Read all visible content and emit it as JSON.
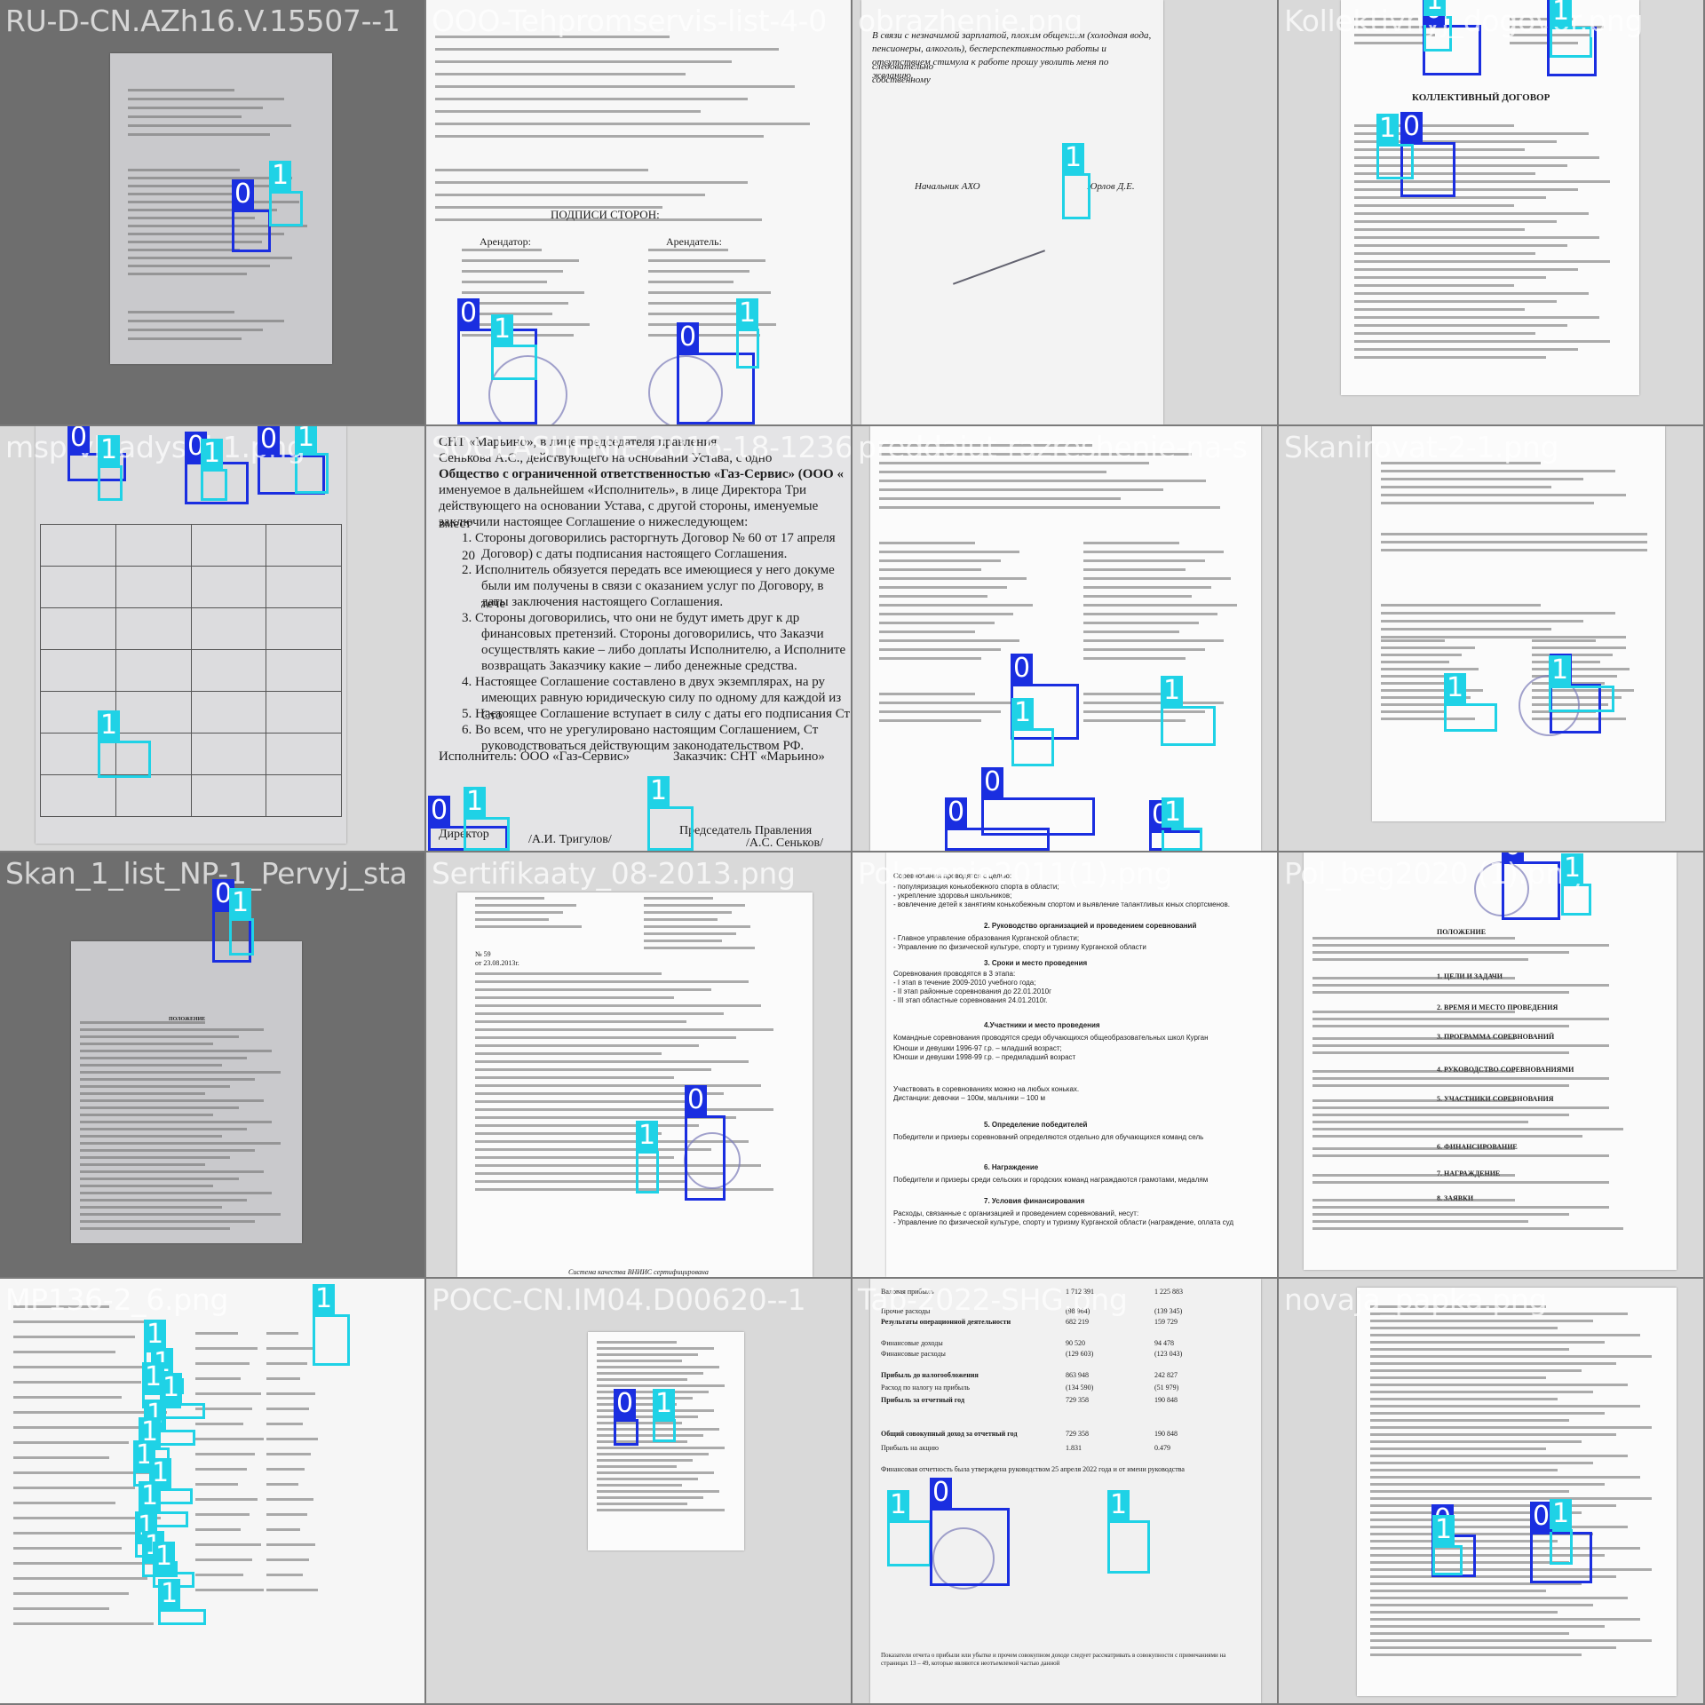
{
  "tiles": [
    {
      "filename": "RU-D-CN.AZh16.V.15507--1"
    },
    {
      "filename": "OOO-Tehpromservis-list-4-0"
    },
    {
      "filename": "obrazhenie.png"
    },
    {
      "filename": "Kollektivnyj_dogovor.png"
    },
    {
      "filename": "msp-vkladyshi-1.png"
    },
    {
      "filename": "SOGLASHENIE-2016-18-1236817870"
    },
    {
      "filename": "preddaiut-razreshenie-na-s"
    },
    {
      "filename": "Skanirovat-2-1.png"
    },
    {
      "filename": "Skan_1_list_NP-1_Pervyj_sta"
    },
    {
      "filename": "Sertifikaaty_08-2013.png"
    },
    {
      "filename": "Polozenie2011(1).png"
    },
    {
      "filename": "Pol_beg2020 (1).png"
    },
    {
      "filename": "MP136-2_6.png"
    },
    {
      "filename": "POCC-CN.IM04.D00620--1"
    },
    {
      "filename": "Tab-2022-SHG.png"
    },
    {
      "filename": "novaja_papka.png"
    }
  ],
  "class_labels": {
    "c0": "0",
    "c1": "1"
  },
  "colors": {
    "class0": "#1a2ee0",
    "class1": "#1fd2e6",
    "background": "#7a7a7a"
  },
  "doc_text": {
    "sogl_p1": "1. Стороны договорились расторгнуть Договор № 60 от 17 апреля 20",
    "sogl_p1b": "Договор) с даты подписания настоящего Соглашения.",
    "sogl_p2": "2. Исполнитель обязуется передать все имеющиеся у него докуме",
    "sogl_p2b": "были им получены в связи с оказанием услуг по Договору, в тече",
    "sogl_p2c": "даты заключения настоящего Соглашения.",
    "sogl_p3": "3. Стороны договорились, что они не будут иметь друг к др",
    "sogl_p3b": "финансовых претензий. Стороны договорились, что Заказчи",
    "sogl_p3c": "осуществлять какие – либо доплаты Исполнителю, а Исполните",
    "sogl_p3d": "возвращать Заказчику какие – либо денежные средства.",
    "sogl_p4": "4. Настоящее Соглашение составлено в двух экземплярах, на ру",
    "sogl_p4b": "имеющих равную юридическую силу по одному для каждой из Сто",
    "sogl_p5": "5. Настоящее Соглашение вступает в силу с даты его подписания Ст",
    "sogl_p6": "6. Во всем, что не урегулировано настоящим Соглашением, Ст",
    "sogl_p6b": "руководствоваться действующим законодательством РФ.",
    "sogl_head": "СНТ «Марьино», в лице председателя правления",
    "sogl_head2": "Сенькова А.С., действующего на основании Устава, с одно",
    "sogl_head3": "Общество с ограниченной ответственностью «Газ-Сервис» (ООО «",
    "sogl_head4": "именуемое в дальнейшем «Исполнитель», в лице Директора Три",
    "sogl_head5": "действующего на основании Устава, с другой стороны, именуемые вмест",
    "sogl_head6": "заключили настоящее Соглашение о нижеследующем:",
    "sogl_exec": "Исполнитель: ООО «Газ-Сервис»",
    "sogl_cust": "Заказчик: СНТ «Марьино»",
    "sogl_sign1": "Директор",
    "sogl_sign1b": "/А.И. Тригулов/",
    "sogl_sign2": "Председатель Правления",
    "sogl_sign2b": "/А.С. Сеньков/",
    "obr_text1": "В связи с незначимой зарплатой, плохим общением (холодная вода,",
    "obr_text2": "пенсионеры, алкоголь), бесперспективностью работы и следовательно",
    "obr_text3": "отсутствием стимула к работе прошу уволить меня по собственному",
    "obr_text4": "желанию.",
    "obr_sign_role": "Начальник АХО",
    "obr_sign_name": "Юрлов Д.Е.",
    "pol_h2": "2. Руководство организацией и проведением соревнований",
    "pol_h3": "3. Сроки и место проведения",
    "pol_h4": "4.Участники и место проведения",
    "pol_h5": "5. Определение победителей",
    "pol_h6": "6. Награждение",
    "pol_h7": "7. Условия финансирования",
    "pol_i1": "Соревнования проводятся с целью:",
    "pol_i2": "- популяризация конькобежного спорта в области;",
    "pol_i3": "- укрепление здоровья школьников;",
    "pol_i4": "- вовлечение детей к занятиям конькобежным спортом и выявление талантливых юных спортсменов.",
    "pol_i5": "- Главное управление образования Курганской области;",
    "pol_i6": "- Управление по физической культуре, спорту и туризму Курганской области",
    "pol_i7": "Соревнования проводятся в 3 этапа:",
    "pol_i8": "- I этап в течение 2009-2010 учебного года;",
    "pol_i9": "- II этап районные соревнования до 22.01.2010г",
    "pol_i10": "- III этап областные соревнования 24.01.2010г.",
    "pol_i11": "Командные соревнования проводятся среди обучающихся общеобразовательных школ Курган",
    "pol_i12": "Юноши и девушки 1996-97 г.р. – младший возраст;",
    "pol_i13": "Юноши и девушки 1998-99 г.р. – предмладший возраст",
    "pol_i14": "Участвовать в соревнованиях можно на любых коньках.",
    "pol_i15": "Дистанции: девочки – 100м, мальчики – 100 м",
    "pol_i16": "Победители и призеры соревнований определяются отдельно для обучающихся команд сель",
    "pol_i17": "Победители и призеры среди сельских и городских команд награждаются грамотами, медалям",
    "pol_i18": "Расходы, связанные с организацией и проведением соревнований, несут:",
    "pol_i19": "- Управление по физической культуре, спорту и туризму Курганской области (награждение, оплата суд",
    "tab_r1": "Валовая прибыль",
    "tab_r2": "Прочие расходы",
    "tab_r3": "Результаты операционной деятельности",
    "tab_r4": "Финансовые доходы",
    "tab_r5": "Финансовые расходы",
    "tab_r6": "Прибыль до налогообложения",
    "tab_r7": "Расход по налогу на прибыль",
    "tab_r8": "Прибыль за отчетный год",
    "tab_r9": "Общий совокупный доход за отчетный год",
    "tab_r10": "Прибыль на акцию",
    "tab_v1": "1 712 391",
    "tab_v2": "(98 964)",
    "tab_v3": "682 219",
    "tab_v4": "90 520",
    "tab_v5": "(129 603)",
    "tab_v6": "863 948",
    "tab_v7": "(134 590)",
    "tab_v8": "729 358",
    "tab_v9": "729 358",
    "tab_v10": "1.831",
    "tab_w1": "1 225 883",
    "tab_w2": "(139 345)",
    "tab_w3": "159 729",
    "tab_w4": "94 478",
    "tab_w5": "(123 043)",
    "tab_w6": "242 827",
    "tab_w7": "(51 979)",
    "tab_w8": "190 848",
    "tab_w9": "190 848",
    "tab_w10": "0.479",
    "tab_note": "Финансовая отчетность была утверждена руководством 25 апреля 2022 года и от имени руководства",
    "tab_foot": "Показатели отчета о прибыли или убытке и прочем совокупном доходе следует рассматривать в совокупности с примечаниями на страницах 13 – 49, которые являются неотъемлемой частью данной",
    "cert_no": "№ 59",
    "cert_date": "от 23.08.2013г.",
    "cert_foot": "Система качества ВНИИС сертифицирована",
    "pb_head": "ПОЛОЖЕНИЕ",
    "pb_s1": "1. ЦЕЛИ И ЗАДАЧИ",
    "pb_s2": "2. ВРЕМЯ И МЕСТО ПРОВЕДЕНИЯ",
    "pb_s3": "3. ПРОГРАММА СОРЕВНОВАНИЙ",
    "pb_s4": "4. РУКОВОДСТВО СОРЕВНОВАНИЯМИ",
    "pb_s5": "5. УЧАСТНИКИ СОРЕВНОВАНИЯ",
    "pb_s6": "6. ФИНАНСИРОВАНИЕ",
    "pb_s7": "7. НАГРАЖДЕНИЕ",
    "pb_s8": "8. ЗАЯВКИ",
    "kd_title": "КОЛЛЕКТИВНЫЙ ДОГОВОР",
    "np_head": "ПОЛОЖЕНИЕ",
    "ozh_sign": "ПОДПИСИ СТОРОН:",
    "ozh_a": "Арендатель:",
    "ozh_b": "Арендатор:"
  }
}
